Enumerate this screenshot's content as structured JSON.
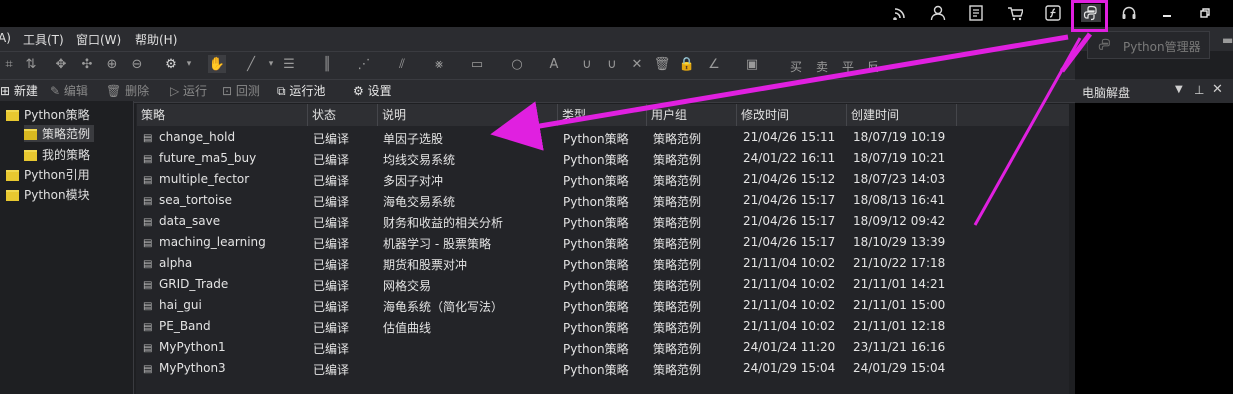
{
  "menubar": {
    "items": [
      "A)",
      "工具(T)",
      "窗口(W)",
      "帮助(H)"
    ]
  },
  "toolbar": {
    "trade_labels": [
      "买",
      "卖",
      "平",
      "反"
    ]
  },
  "actions": {
    "new": "新建",
    "edit": "编辑",
    "delete": "删除",
    "run": "运行",
    "backtest": "回测",
    "run_pool": "运行池",
    "settings": "设置"
  },
  "python_manager": {
    "label": "Python管理器"
  },
  "right_panel": {
    "title": "电脑解盘"
  },
  "tree": {
    "items": [
      {
        "label": "Python策略"
      },
      {
        "label": "策略范例"
      },
      {
        "label": "我的策略"
      },
      {
        "label": "Python引用"
      },
      {
        "label": "Python模块"
      }
    ]
  },
  "table": {
    "columns": [
      "策略",
      "状态",
      "说明",
      "类型",
      "用户组",
      "修改时间",
      "创建时间"
    ],
    "rows": [
      {
        "name": "change_hold",
        "status": "已编译",
        "desc": "单因子选股",
        "type": "Python策略",
        "group": "策略范例",
        "modified": "21/04/26 15:11",
        "created": "18/07/19 10:19"
      },
      {
        "name": "future_ma5_buy",
        "status": "已编译",
        "desc": "均线交易系统",
        "type": "Python策略",
        "group": "策略范例",
        "modified": "24/01/22 16:11",
        "created": "18/07/19 10:21"
      },
      {
        "name": "multiple_fector",
        "status": "已编译",
        "desc": "多因子对冲",
        "type": "Python策略",
        "group": "策略范例",
        "modified": "21/04/26 15:12",
        "created": "18/07/23 14:03"
      },
      {
        "name": "sea_tortoise",
        "status": "已编译",
        "desc": "海龟交易系统",
        "type": "Python策略",
        "group": "策略范例",
        "modified": "21/04/26 15:17",
        "created": "18/08/13 16:41"
      },
      {
        "name": "data_save",
        "status": "已编译",
        "desc": "财务和收益的相关分析",
        "type": "Python策略",
        "group": "策略范例",
        "modified": "21/04/26 15:17",
        "created": "18/09/12 09:42"
      },
      {
        "name": "maching_learning",
        "status": "已编译",
        "desc": "机器学习 - 股票策略",
        "type": "Python策略",
        "group": "策略范例",
        "modified": "21/04/26 15:17",
        "created": "18/10/29 13:39"
      },
      {
        "name": "alpha",
        "status": "已编译",
        "desc": "期货和股票对冲",
        "type": "Python策略",
        "group": "策略范例",
        "modified": "21/11/04 10:02",
        "created": "21/10/22 17:18"
      },
      {
        "name": "GRID_Trade",
        "status": "已编译",
        "desc": "网格交易",
        "type": "Python策略",
        "group": "策略范例",
        "modified": "21/11/04 10:02",
        "created": "21/11/01 14:21"
      },
      {
        "name": "hai_gui",
        "status": "已编译",
        "desc": "海龟系统（简化写法）",
        "type": "Python策略",
        "group": "策略范例",
        "modified": "21/11/04 10:02",
        "created": "21/11/01 15:00"
      },
      {
        "name": "PE_Band",
        "status": "已编译",
        "desc": "估值曲线",
        "type": "Python策略",
        "group": "策略范例",
        "modified": "21/11/04 10:02",
        "created": "21/11/01 12:18"
      },
      {
        "name": "MyPython1",
        "status": "已编译",
        "desc": "",
        "type": "Python策略",
        "group": "策略范例",
        "modified": "24/01/24 11:20",
        "created": "23/11/21 16:16"
      },
      {
        "name": "MyPython3",
        "status": "已编译",
        "desc": "",
        "type": "Python策略",
        "group": "策略范例",
        "modified": "24/01/29 15:04",
        "created": "24/01/29 15:04"
      }
    ]
  },
  "colors": {
    "annotation": "#e020e0",
    "folder": "#e8c830",
    "panel_bg": "#000000"
  }
}
